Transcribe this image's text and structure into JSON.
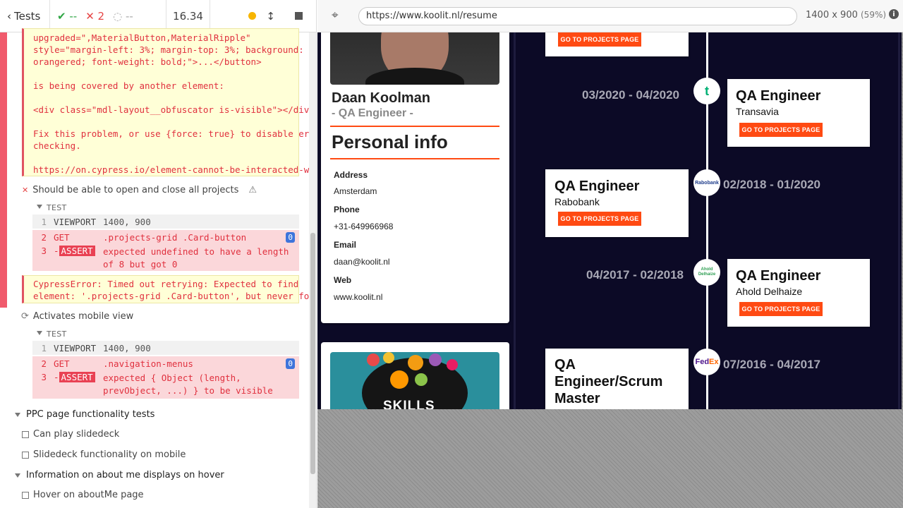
{
  "reporter": {
    "tests_label": "Tests",
    "passed": "--",
    "failed": "2",
    "pending": "--",
    "duration": "16.34",
    "error1": {
      "lines": [
        "upgraded=\",MaterialButton,MaterialRipple\"",
        "style=\"margin-left: 3%; margin-top: 3%; background:",
        "orangered; font-weight: bold;\">...</button>",
        "",
        "is being covered by another element:",
        "",
        "<div class=\"mdl-layout__obfuscator is-visible\"></div>",
        "",
        "Fix this problem, or use {force: true} to disable error",
        "checking.",
        "",
        "https://on.cypress.io/element-cannot-be-interacted-with"
      ]
    },
    "test1": {
      "title": "Should be able to open and close all projects",
      "section": "TEST",
      "commands": [
        {
          "num": "1",
          "name": "VIEWPORT",
          "value": "1400, 900"
        },
        {
          "num": "2",
          "name": "GET",
          "value": ".projects-grid .Card-button",
          "badge": "0"
        },
        {
          "num": "3",
          "name": "ASSERT",
          "value_line1": "expected undefined to have a length",
          "value_line2": "of 8 but got 0"
        }
      ],
      "error_lines": [
        "CypressError: Timed out retrying: Expected to find",
        "element: '.projects-grid .Card-button', but never found it."
      ]
    },
    "test2": {
      "title": "Activates mobile view",
      "section": "TEST",
      "commands": [
        {
          "num": "1",
          "name": "VIEWPORT",
          "value": "1400, 900"
        },
        {
          "num": "2",
          "name": "GET",
          "value": ".navigation-menus",
          "badge": "0"
        },
        {
          "num": "3",
          "name": "ASSERT",
          "value_line1": "expected { Object (length,",
          "value_line2": "prevObject, ...) } to be visible"
        }
      ]
    },
    "suites": [
      {
        "title": "PPC page functionality tests",
        "tests": [
          "Can play slidedeck",
          "Slidedeck functionality on mobile"
        ]
      },
      {
        "title": "Information on about me displays on hover",
        "tests": [
          "Hover on aboutMe page"
        ]
      }
    ]
  },
  "browser": {
    "url": "https://www.koolit.nl/resume",
    "viewport_info": "1400 x 900",
    "scale": "(59%)"
  },
  "resume": {
    "name": "Daan Koolman",
    "role": "- QA Engineer -",
    "personal_heading": "Personal info",
    "fields": [
      {
        "label": "Address",
        "value": "Amsterdam"
      },
      {
        "label": "Phone",
        "value": "+31-649966968"
      },
      {
        "label": "Email",
        "value": "daan@koolit.nl"
      },
      {
        "label": "Web",
        "value": "www.koolit.nl"
      }
    ],
    "skills_label": "SKILLS",
    "button_label": "GO TO PROJECTS PAGE",
    "timeline": [
      {
        "date": "03/2020 - 04/2020",
        "title": "QA Engineer",
        "company": "Transavia",
        "logo": "transavia"
      },
      {
        "date": "02/2018 - 01/2020",
        "title": "QA Engineer",
        "company": "Rabobank",
        "logo": "Rabobank"
      },
      {
        "date": "04/2017 - 02/2018",
        "title": "QA Engineer",
        "company": "Ahold Delhaize",
        "logo": "Ahold Delhaize"
      },
      {
        "date": "07/2016 - 04/2017",
        "title_lines": [
          "QA",
          "Engineer/Scrum",
          "Master"
        ],
        "logo": "FedEx"
      }
    ]
  }
}
